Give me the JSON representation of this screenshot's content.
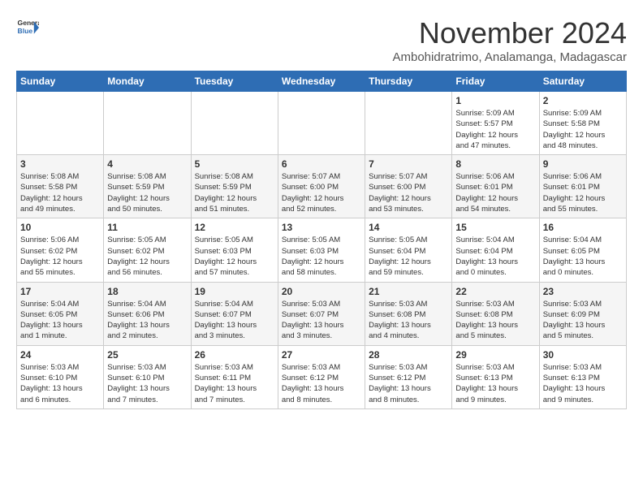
{
  "header": {
    "logo_line1": "General",
    "logo_line2": "Blue",
    "month_title": "November 2024",
    "location": "Ambohidratrimo, Analamanga, Madagascar"
  },
  "days_of_week": [
    "Sunday",
    "Monday",
    "Tuesday",
    "Wednesday",
    "Thursday",
    "Friday",
    "Saturday"
  ],
  "weeks": [
    [
      {
        "day": "",
        "info": ""
      },
      {
        "day": "",
        "info": ""
      },
      {
        "day": "",
        "info": ""
      },
      {
        "day": "",
        "info": ""
      },
      {
        "day": "",
        "info": ""
      },
      {
        "day": "1",
        "info": "Sunrise: 5:09 AM\nSunset: 5:57 PM\nDaylight: 12 hours\nand 47 minutes."
      },
      {
        "day": "2",
        "info": "Sunrise: 5:09 AM\nSunset: 5:58 PM\nDaylight: 12 hours\nand 48 minutes."
      }
    ],
    [
      {
        "day": "3",
        "info": "Sunrise: 5:08 AM\nSunset: 5:58 PM\nDaylight: 12 hours\nand 49 minutes."
      },
      {
        "day": "4",
        "info": "Sunrise: 5:08 AM\nSunset: 5:59 PM\nDaylight: 12 hours\nand 50 minutes."
      },
      {
        "day": "5",
        "info": "Sunrise: 5:08 AM\nSunset: 5:59 PM\nDaylight: 12 hours\nand 51 minutes."
      },
      {
        "day": "6",
        "info": "Sunrise: 5:07 AM\nSunset: 6:00 PM\nDaylight: 12 hours\nand 52 minutes."
      },
      {
        "day": "7",
        "info": "Sunrise: 5:07 AM\nSunset: 6:00 PM\nDaylight: 12 hours\nand 53 minutes."
      },
      {
        "day": "8",
        "info": "Sunrise: 5:06 AM\nSunset: 6:01 PM\nDaylight: 12 hours\nand 54 minutes."
      },
      {
        "day": "9",
        "info": "Sunrise: 5:06 AM\nSunset: 6:01 PM\nDaylight: 12 hours\nand 55 minutes."
      }
    ],
    [
      {
        "day": "10",
        "info": "Sunrise: 5:06 AM\nSunset: 6:02 PM\nDaylight: 12 hours\nand 55 minutes."
      },
      {
        "day": "11",
        "info": "Sunrise: 5:05 AM\nSunset: 6:02 PM\nDaylight: 12 hours\nand 56 minutes."
      },
      {
        "day": "12",
        "info": "Sunrise: 5:05 AM\nSunset: 6:03 PM\nDaylight: 12 hours\nand 57 minutes."
      },
      {
        "day": "13",
        "info": "Sunrise: 5:05 AM\nSunset: 6:03 PM\nDaylight: 12 hours\nand 58 minutes."
      },
      {
        "day": "14",
        "info": "Sunrise: 5:05 AM\nSunset: 6:04 PM\nDaylight: 12 hours\nand 59 minutes."
      },
      {
        "day": "15",
        "info": "Sunrise: 5:04 AM\nSunset: 6:04 PM\nDaylight: 13 hours\nand 0 minutes."
      },
      {
        "day": "16",
        "info": "Sunrise: 5:04 AM\nSunset: 6:05 PM\nDaylight: 13 hours\nand 0 minutes."
      }
    ],
    [
      {
        "day": "17",
        "info": "Sunrise: 5:04 AM\nSunset: 6:05 PM\nDaylight: 13 hours\nand 1 minute."
      },
      {
        "day": "18",
        "info": "Sunrise: 5:04 AM\nSunset: 6:06 PM\nDaylight: 13 hours\nand 2 minutes."
      },
      {
        "day": "19",
        "info": "Sunrise: 5:04 AM\nSunset: 6:07 PM\nDaylight: 13 hours\nand 3 minutes."
      },
      {
        "day": "20",
        "info": "Sunrise: 5:03 AM\nSunset: 6:07 PM\nDaylight: 13 hours\nand 3 minutes."
      },
      {
        "day": "21",
        "info": "Sunrise: 5:03 AM\nSunset: 6:08 PM\nDaylight: 13 hours\nand 4 minutes."
      },
      {
        "day": "22",
        "info": "Sunrise: 5:03 AM\nSunset: 6:08 PM\nDaylight: 13 hours\nand 5 minutes."
      },
      {
        "day": "23",
        "info": "Sunrise: 5:03 AM\nSunset: 6:09 PM\nDaylight: 13 hours\nand 5 minutes."
      }
    ],
    [
      {
        "day": "24",
        "info": "Sunrise: 5:03 AM\nSunset: 6:10 PM\nDaylight: 13 hours\nand 6 minutes."
      },
      {
        "day": "25",
        "info": "Sunrise: 5:03 AM\nSunset: 6:10 PM\nDaylight: 13 hours\nand 7 minutes."
      },
      {
        "day": "26",
        "info": "Sunrise: 5:03 AM\nSunset: 6:11 PM\nDaylight: 13 hours\nand 7 minutes."
      },
      {
        "day": "27",
        "info": "Sunrise: 5:03 AM\nSunset: 6:12 PM\nDaylight: 13 hours\nand 8 minutes."
      },
      {
        "day": "28",
        "info": "Sunrise: 5:03 AM\nSunset: 6:12 PM\nDaylight: 13 hours\nand 8 minutes."
      },
      {
        "day": "29",
        "info": "Sunrise: 5:03 AM\nSunset: 6:13 PM\nDaylight: 13 hours\nand 9 minutes."
      },
      {
        "day": "30",
        "info": "Sunrise: 5:03 AM\nSunset: 6:13 PM\nDaylight: 13 hours\nand 9 minutes."
      }
    ]
  ]
}
